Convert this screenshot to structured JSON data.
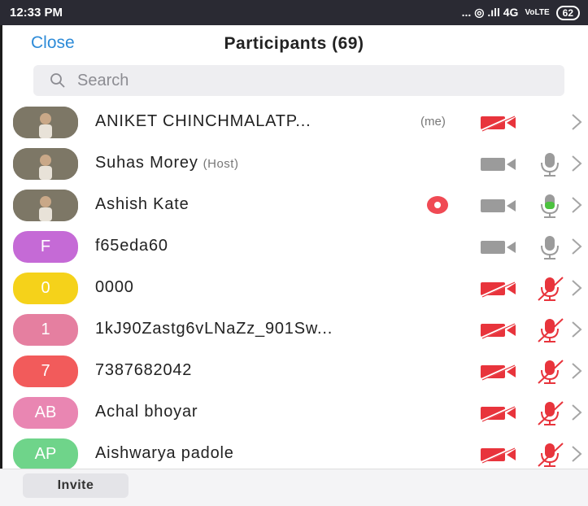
{
  "status_bar": {
    "time": "12:33 PM",
    "indicators": "... ◎ .ıll 4G",
    "network": "VoLTE",
    "battery": "62"
  },
  "header": {
    "close_label": "Close",
    "title": "Participants (69)"
  },
  "search": {
    "placeholder": "Search"
  },
  "participants": [
    {
      "name": "ANIKET CHINCHMALATP...",
      "tag": "(me)",
      "avatar_type": "photo",
      "video": "off",
      "mic": "none",
      "recording": false
    },
    {
      "name": "Suhas Morey",
      "tag": "(Host)",
      "avatar_type": "photo",
      "video": "on",
      "mic": "on",
      "recording": false
    },
    {
      "name": "Ashish Kate",
      "tag": "",
      "avatar_type": "photo",
      "video": "on",
      "mic": "talking",
      "recording": true
    },
    {
      "name": "f65eda60",
      "tag": "",
      "avatar_type": "initials",
      "initials": "F",
      "avatar_color": "#c56ad6",
      "video": "on",
      "mic": "on",
      "recording": false
    },
    {
      "name": "0000",
      "tag": "",
      "avatar_type": "initials",
      "initials": "0",
      "avatar_color": "#f5d21a",
      "video": "off",
      "mic": "off",
      "recording": false
    },
    {
      "name": "1kJ90Zastg6vLNaZz_901Sw...",
      "tag": "",
      "avatar_type": "initials",
      "initials": "1",
      "avatar_color": "#e57fa0",
      "video": "off",
      "mic": "off",
      "recording": false
    },
    {
      "name": "7387682042",
      "tag": "",
      "avatar_type": "initials",
      "initials": "7",
      "avatar_color": "#f25b5b",
      "video": "off",
      "mic": "off",
      "recording": false
    },
    {
      "name": "Achal bhoyar",
      "tag": "",
      "avatar_type": "initials",
      "initials": "AB",
      "avatar_color": "#e986b2",
      "video": "off",
      "mic": "off",
      "recording": false
    },
    {
      "name": "Aishwarya padole",
      "tag": "",
      "avatar_type": "initials",
      "initials": "AP",
      "avatar_color": "#6fd48a",
      "video": "off",
      "mic": "off",
      "recording": false
    }
  ],
  "footer": {
    "invite_label": "Invite"
  },
  "colors": {
    "accent": "#2d8bd8",
    "muted_red": "#e8343c",
    "icon_gray": "#9b9b9b",
    "talking_green": "#4cc23f"
  }
}
